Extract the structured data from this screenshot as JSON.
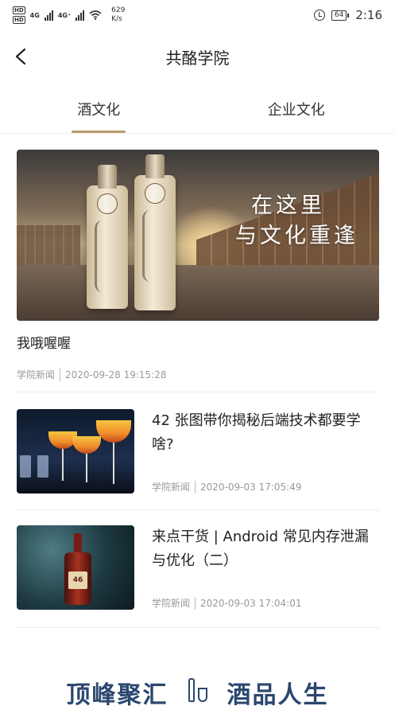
{
  "status_bar": {
    "hd1": "HD",
    "hd2": "HD",
    "net1": "4G",
    "net2": "4G⁺",
    "speed_value": "629",
    "speed_unit": "K/s",
    "battery": "64",
    "time": "2:16"
  },
  "header": {
    "title": "共酪学院"
  },
  "tabs": [
    {
      "label": "酒文化",
      "active": true
    },
    {
      "label": "企业文化",
      "active": false
    }
  ],
  "featured": {
    "image_text_line1": "在这里",
    "image_text_line2": "与文化重逢",
    "title": "我哦喔喔",
    "category": "学院新闻",
    "date": "2020-09-28 19:15:28"
  },
  "articles": [
    {
      "title": "42 张图带你揭秘后端技术都要学啥?",
      "category": "学院新闻",
      "date": "2020-09-03 17:05:49",
      "thumb_label": ""
    },
    {
      "title": "来点干货 | Android 常见内存泄漏与优化（二）",
      "category": "学院新闻",
      "date": "2020-09-03 17:04:01",
      "thumb_label": "46"
    }
  ],
  "banner": {
    "left_text": "顶峰聚汇",
    "right_text": "酒品人生"
  },
  "colors": {
    "accent": "#b99a6c",
    "banner": "#2b4770"
  }
}
